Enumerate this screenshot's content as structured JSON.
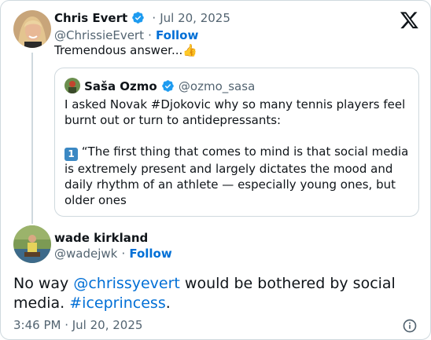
{
  "parent": {
    "name": "Chris Evert",
    "date": "Jul 20, 2025",
    "handle": "@ChrissieEvert",
    "follow_label": "Follow",
    "text": "Tremendous answer...",
    "emoji": "👍"
  },
  "quote": {
    "name": "Saša Ozmo",
    "handle": "@ozmo_sasa",
    "line1": "I asked Novak #Djokovic why so many tennis players feel burnt out or turn to antidepressants:",
    "keycap": "1",
    "line2": "“The first thing that comes to mind is that social media is extremely present and largely dictates the mood and daily rhythm of an athlete — especially young ones, but older ones"
  },
  "reply": {
    "name": "wade kirkland",
    "handle": "@wadejwk",
    "follow_label": "Follow",
    "text_before": "No way ",
    "mention": "@chrissyevert",
    "text_middle": " would be bothered by social media.  ",
    "hashtag": "#iceprincess",
    "text_after": ".",
    "timestamp": "3:46 PM · Jul 20, 2025"
  },
  "colors": {
    "link": "#006fd6",
    "verified": "#1d9bf0",
    "secondary_text": "#536471",
    "border": "#cfd9de"
  }
}
